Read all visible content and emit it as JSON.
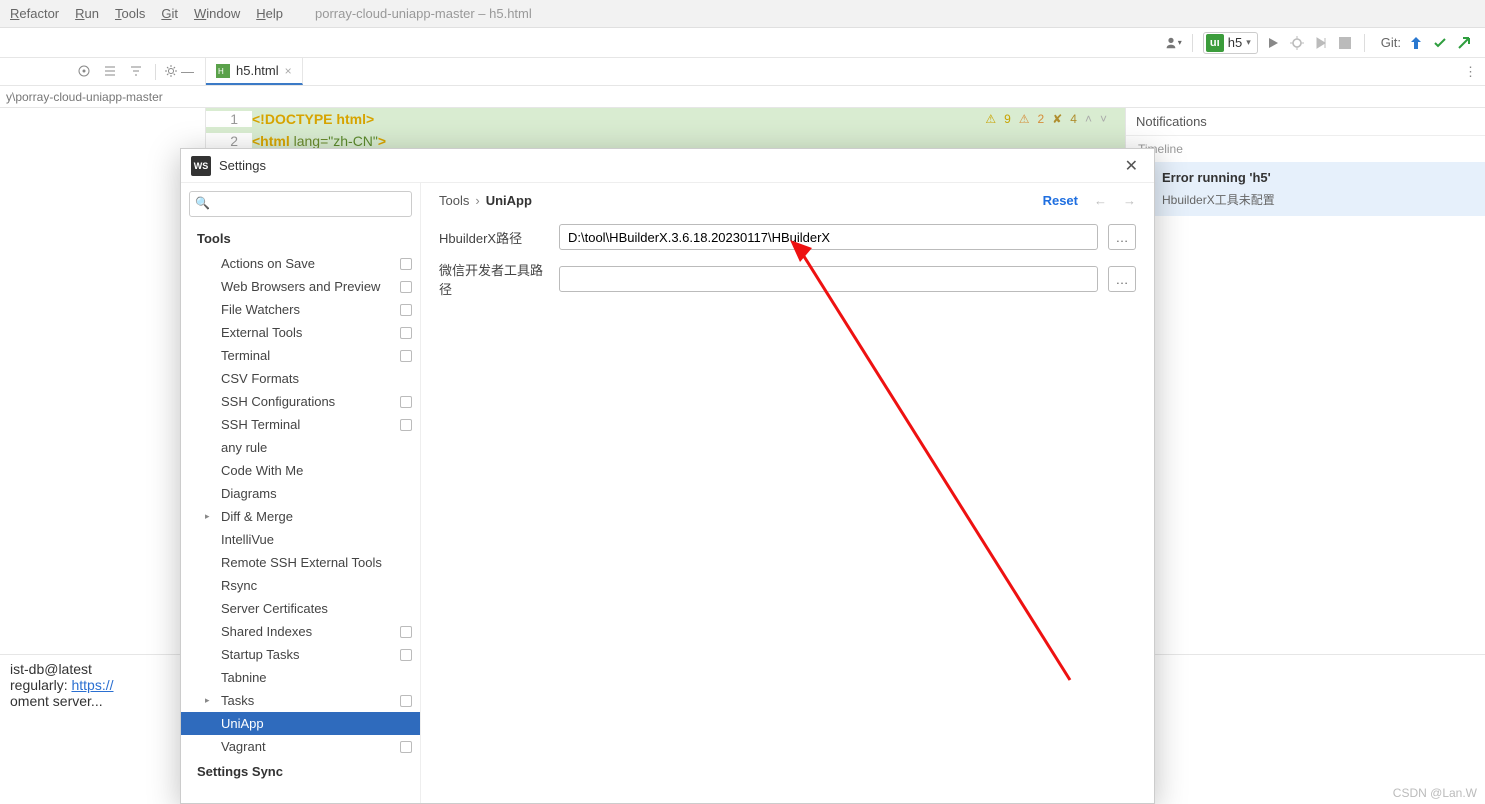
{
  "menu": {
    "items": [
      "Refactor",
      "Run",
      "Tools",
      "Git",
      "Window",
      "Help"
    ],
    "title": "porray-cloud-uniapp-master – h5.html"
  },
  "toolbar": {
    "run_config_label": "h5",
    "git_label": "Git:"
  },
  "breadcrumb_left": "y\\porray-cloud-uniapp-master",
  "tab": {
    "label": "h5.html"
  },
  "code": {
    "hints": {
      "warn": "9",
      "err": "2",
      "weak": "4"
    },
    "lines": [
      {
        "n": "1",
        "raw": "<!DOCTYPE html>"
      },
      {
        "n": "2",
        "raw": "<html lang=\"zh-CN\">"
      }
    ]
  },
  "notifications": {
    "header": "Notifications",
    "timeline": "Timeline",
    "item": {
      "title": "Error running 'h5'",
      "body": "HbuilderX工具未配置"
    }
  },
  "terminal": {
    "l1": "ist-db@latest",
    "l2a": " regularly: ",
    "l2b": "https://",
    "l3": "oment server..."
  },
  "settings": {
    "title": "Settings",
    "search_placeholder": "",
    "group_tools": "Tools",
    "tree": [
      "Actions on Save",
      "Web Browsers and Preview",
      "File Watchers",
      "External Tools",
      "Terminal",
      "CSV Formats",
      "SSH Configurations",
      "SSH Terminal",
      "any rule",
      "Code With Me",
      "Diagrams",
      "Diff & Merge",
      "IntelliVue",
      "Remote SSH External Tools",
      "Rsync",
      "Server Certificates",
      "Shared Indexes",
      "Startup Tasks",
      "Tabnine",
      "Tasks",
      "UniApp",
      "Vagrant"
    ],
    "group_sync": "Settings Sync",
    "crumb1": "Tools",
    "crumb2": "UniApp",
    "reset": "Reset",
    "row1_label": "HbuilderX路径",
    "row1_value": "D:\\tool\\HBuilderX.3.6.18.20230117\\HBuilderX",
    "row2_label": "微信开发者工具路径",
    "row2_value": ""
  },
  "watermark": "CSDN @Lan.W"
}
